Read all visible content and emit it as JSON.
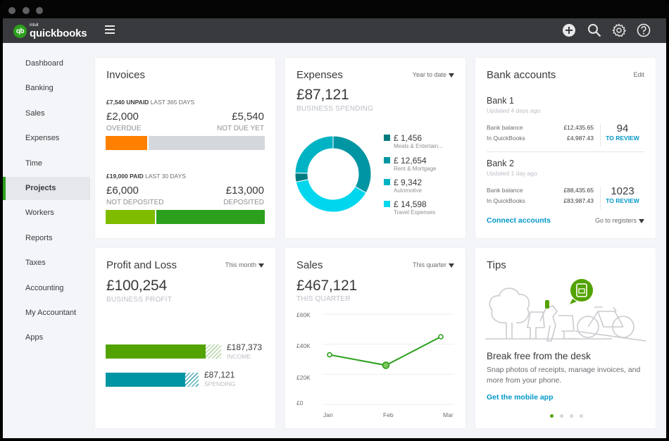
{
  "app": {
    "brand_small": "intuit",
    "brand": "quickbooks",
    "brand_badge": "qb",
    "top_icons": [
      "plus-circle-icon",
      "search-icon",
      "gear-icon",
      "help-icon"
    ]
  },
  "sidebar": {
    "items": [
      {
        "label": "Dashboard",
        "active": false
      },
      {
        "label": "Banking",
        "active": false
      },
      {
        "label": "Sales",
        "active": false
      },
      {
        "label": "Expenses",
        "active": false
      },
      {
        "label": "Time",
        "active": false
      },
      {
        "label": "Projects",
        "active": true
      },
      {
        "label": "Workers",
        "active": false
      },
      {
        "label": "Reports",
        "active": false
      },
      {
        "label": "Taxes",
        "active": false
      },
      {
        "label": "Accounting",
        "active": false
      },
      {
        "label": "My Accountant",
        "active": false
      },
      {
        "label": "Apps",
        "active": false
      }
    ]
  },
  "invoices": {
    "title": "Invoices",
    "unpaid_amount": "£7,540 UNPAID",
    "unpaid_period": "LAST 365 DAYS",
    "overdue_amount": "£2,000",
    "overdue_label": "OVERDUE",
    "not_due_amount": "£5,540",
    "not_due_label": "NOT DUE YET",
    "unpaid_split": {
      "overdue": 2000,
      "not_due": 5540
    },
    "paid_amount": "£19,000 PAID",
    "paid_period": "LAST 30 DAYS",
    "not_deposited_amount": "£6,000",
    "not_deposited_label": "NOT DEPOSITED",
    "deposited_amount": "£13,000",
    "deposited_label": "DEPOSITED",
    "paid_split": {
      "not_deposited": 6000,
      "deposited": 13000
    },
    "colors": {
      "overdue": "#ff8000",
      "not_due": "#d4d7dc",
      "not_deposited": "#7fbc00",
      "deposited": "#2ca01c"
    }
  },
  "expenses": {
    "title": "Expenses",
    "period": "Year to date",
    "total": "£87,121",
    "total_label": "BUSINESS SPENDING",
    "categories": [
      {
        "amount": "£ 1,456",
        "label": "Meals & Entertain...",
        "color": "#007b7f"
      },
      {
        "amount": "£ 12,654",
        "label": "Rent & Mortgage",
        "color": "#0095a3"
      },
      {
        "amount": "£ 9,342",
        "label": "Automotive",
        "color": "#00b3c4"
      },
      {
        "amount": "£ 14,598",
        "label": "Travel Expenses",
        "color": "#00d7ee"
      }
    ]
  },
  "bank_accounts": {
    "title": "Bank accounts",
    "edit_label": "Edit",
    "accounts": [
      {
        "name": "Bank 1",
        "updated": "Updated 4 days ago",
        "bank_balance_label": "Bank balance",
        "bank_balance": "£12,435.65",
        "in_qb_label": "In QuickBooks",
        "in_qb": "£4,987.43",
        "review_count": "94",
        "review_label": "TO REVIEW"
      },
      {
        "name": "Bank 2",
        "updated": "Updated 1 day ago",
        "bank_balance_label": "Bank balance",
        "bank_balance": "£88,435.65",
        "in_qb_label": "In QuickBooks",
        "in_qb": "£83,987.43",
        "review_count": "1023",
        "review_label": "TO REVIEW"
      }
    ],
    "connect_label": "Connect accounts",
    "registers_label": "Go to registers"
  },
  "profit_loss": {
    "title": "Profit and Loss",
    "period": "This month",
    "total": "£100,254",
    "total_label": "BUSINESS PROFIT",
    "income_amount": "£187,373",
    "income_label": "INCOME",
    "spending_amount": "£87,121",
    "spending_label": "SPENDING",
    "colors": {
      "income": "#53a300",
      "spending": "#0095a3"
    }
  },
  "sales": {
    "title": "Sales",
    "period": "This quarter",
    "total": "£467,121",
    "total_label": "THIS QUARTER"
  },
  "chart_data": {
    "type": "line",
    "title": "Sales",
    "categories": [
      "Jan",
      "Feb",
      "Mar"
    ],
    "series": [
      {
        "name": "Sales",
        "values": [
          33000,
          26000,
          45000
        ],
        "color": "#2ca01c"
      }
    ],
    "ylim": [
      0,
      60000
    ],
    "yticks": [
      "£0",
      "£20K",
      "£40K",
      "£60K"
    ],
    "ytick_values": [
      0,
      20000,
      40000,
      60000
    ],
    "grid": true,
    "highlighted_point": "Feb"
  },
  "tips": {
    "title": "Tips",
    "heading": "Break free from the desk",
    "body": "Snap photos of receipts, manage invoices, and more from your phone.",
    "link": "Get the mobile app",
    "pages": 4,
    "active_page": 1
  }
}
